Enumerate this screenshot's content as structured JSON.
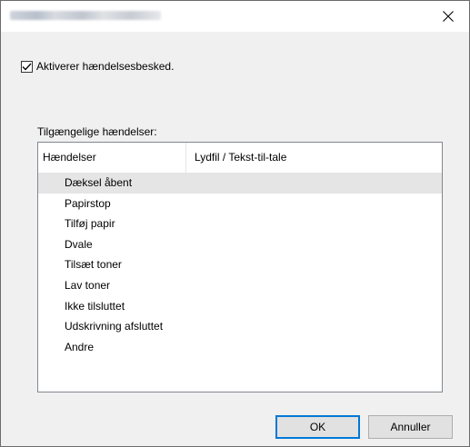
{
  "window": {
    "title": "",
    "close_icon": "close-icon"
  },
  "enable": {
    "checked": true,
    "label": "Aktiverer hændelsesbesked."
  },
  "events": {
    "caption": "Tilgængelige hændelser:",
    "columns": [
      "Hændelser",
      "Lydfil / Tekst-til-tale"
    ],
    "rows": [
      {
        "event": "Dæksel åbent",
        "sound": "",
        "selected": true
      },
      {
        "event": "Papirstop",
        "sound": ""
      },
      {
        "event": "Tilføj papir",
        "sound": ""
      },
      {
        "event": "Dvale",
        "sound": ""
      },
      {
        "event": "Tilsæt toner",
        "sound": ""
      },
      {
        "event": "Lav toner",
        "sound": ""
      },
      {
        "event": "Ikke tilsluttet",
        "sound": ""
      },
      {
        "event": "Udskrivning afsluttet",
        "sound": ""
      },
      {
        "event": "Andre",
        "sound": ""
      }
    ]
  },
  "buttons": {
    "ok": "OK",
    "cancel": "Annuller"
  },
  "colors": {
    "selection": "#e5e5e5",
    "default_button_border": "#0078d7",
    "dialog_background": "#f0f0f0"
  }
}
